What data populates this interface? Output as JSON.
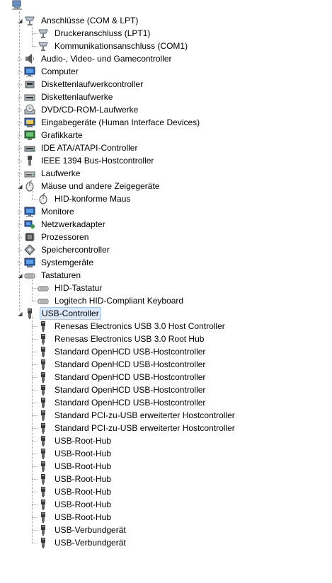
{
  "tree": {
    "root": {
      "label": "",
      "icon": "computer-icon"
    },
    "categories": [
      {
        "label": "Anschlüsse (COM & LPT)",
        "icon": "port-icon",
        "expanded": true,
        "children": [
          {
            "label": "Druckeranschluss (LPT1)",
            "icon": "port-icon"
          },
          {
            "label": "Kommunikationsanschluss (COM1)",
            "icon": "port-icon"
          }
        ]
      },
      {
        "label": "Audio-, Video- und Gamecontroller",
        "icon": "speaker-icon",
        "expanded": false,
        "children": []
      },
      {
        "label": "Computer",
        "icon": "monitor-icon",
        "expanded": false,
        "children": []
      },
      {
        "label": "Diskettenlaufwerkcontroller",
        "icon": "floppy-controller-icon",
        "expanded": false,
        "children": []
      },
      {
        "label": "Diskettenlaufwerke",
        "icon": "floppy-drive-icon",
        "expanded": false,
        "children": []
      },
      {
        "label": "DVD/CD-ROM-Laufwerke",
        "icon": "disc-drive-icon",
        "expanded": false,
        "children": []
      },
      {
        "label": "Eingabegeräte (Human Interface Devices)",
        "icon": "hid-icon",
        "expanded": false,
        "children": []
      },
      {
        "label": "Grafikkarte",
        "icon": "display-adapter-icon",
        "expanded": false,
        "children": []
      },
      {
        "label": "IDE ATA/ATAPI-Controller",
        "icon": "ide-controller-icon",
        "expanded": false,
        "children": []
      },
      {
        "label": "IEEE 1394 Bus-Hostcontroller",
        "icon": "firewire-icon",
        "expanded": false,
        "children": []
      },
      {
        "label": "Laufwerke",
        "icon": "disk-drive-icon",
        "expanded": false,
        "children": []
      },
      {
        "label": "Mäuse und andere Zeigegeräte",
        "icon": "mouse-icon",
        "expanded": true,
        "children": [
          {
            "label": "HID-konforme Maus",
            "icon": "mouse-icon"
          }
        ]
      },
      {
        "label": "Monitore",
        "icon": "monitor-icon",
        "expanded": false,
        "children": []
      },
      {
        "label": "Netzwerkadapter",
        "icon": "network-adapter-icon",
        "expanded": false,
        "children": []
      },
      {
        "label": "Prozessoren",
        "icon": "processor-icon",
        "expanded": false,
        "children": []
      },
      {
        "label": "Speichercontroller",
        "icon": "storage-controller-icon",
        "expanded": false,
        "children": []
      },
      {
        "label": "Systemgeräte",
        "icon": "system-device-icon",
        "expanded": false,
        "children": []
      },
      {
        "label": "Tastaturen",
        "icon": "keyboard-icon",
        "expanded": true,
        "children": [
          {
            "label": "HID-Tastatur",
            "icon": "keyboard-icon"
          },
          {
            "label": "Logitech HID-Compliant Keyboard",
            "icon": "keyboard-icon"
          }
        ]
      },
      {
        "label": "USB-Controller",
        "icon": "usb-icon",
        "expanded": true,
        "selected": true,
        "children": [
          {
            "label": "Renesas Electronics USB 3.0 Host Controller",
            "icon": "usb-icon"
          },
          {
            "label": "Renesas Electronics USB 3.0 Root Hub",
            "icon": "usb-icon"
          },
          {
            "label": "Standard OpenHCD USB-Hostcontroller",
            "icon": "usb-icon"
          },
          {
            "label": "Standard OpenHCD USB-Hostcontroller",
            "icon": "usb-icon"
          },
          {
            "label": "Standard OpenHCD USB-Hostcontroller",
            "icon": "usb-icon"
          },
          {
            "label": "Standard OpenHCD USB-Hostcontroller",
            "icon": "usb-icon"
          },
          {
            "label": "Standard OpenHCD USB-Hostcontroller",
            "icon": "usb-icon"
          },
          {
            "label": "Standard PCI-zu-USB erweiterter Hostcontroller",
            "icon": "usb-icon"
          },
          {
            "label": "Standard PCI-zu-USB erweiterter Hostcontroller",
            "icon": "usb-icon"
          },
          {
            "label": "USB-Root-Hub",
            "icon": "usb-icon"
          },
          {
            "label": "USB-Root-Hub",
            "icon": "usb-icon"
          },
          {
            "label": "USB-Root-Hub",
            "icon": "usb-icon"
          },
          {
            "label": "USB-Root-Hub",
            "icon": "usb-icon"
          },
          {
            "label": "USB-Root-Hub",
            "icon": "usb-icon"
          },
          {
            "label": "USB-Root-Hub",
            "icon": "usb-icon"
          },
          {
            "label": "USB-Root-Hub",
            "icon": "usb-icon"
          },
          {
            "label": "USB-Verbundgerät",
            "icon": "usb-icon"
          },
          {
            "label": "USB-Verbundgerät",
            "icon": "usb-icon"
          }
        ]
      }
    ]
  },
  "colors": {
    "selection_fill": "#dde9f8",
    "selection_border": "#a6c8ef",
    "tree_lines": "#a0a0a0"
  }
}
